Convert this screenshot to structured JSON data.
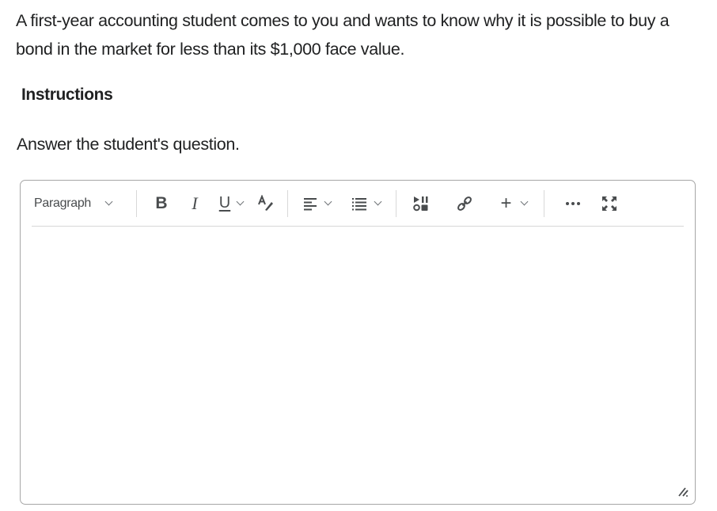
{
  "question": {
    "text": "A first-year accounting student comes to you and wants to know why it is possible to buy a bond in the market for less than its $1,000 face value."
  },
  "instructions": {
    "heading": "Instructions",
    "prompt": "Answer the student's question."
  },
  "editor": {
    "toolbar": {
      "block_format": "Paragraph",
      "buttons": [
        {
          "name": "bold",
          "icon": "bold-icon"
        },
        {
          "name": "italic",
          "icon": "italic-icon"
        },
        {
          "name": "underline",
          "icon": "underline-icon",
          "has_dropdown": true
        },
        {
          "name": "text-color",
          "icon": "text-color-icon"
        },
        {
          "name": "align",
          "icon": "align-left-icon",
          "has_dropdown": true
        },
        {
          "name": "list",
          "icon": "bullet-list-icon",
          "has_dropdown": true
        },
        {
          "name": "media",
          "icon": "media-icon"
        },
        {
          "name": "link",
          "icon": "link-icon"
        },
        {
          "name": "insert",
          "icon": "plus-icon",
          "has_dropdown": true
        },
        {
          "name": "more",
          "icon": "more-icon"
        },
        {
          "name": "fullscreen",
          "icon": "fullscreen-icon"
        }
      ]
    },
    "content": ""
  }
}
